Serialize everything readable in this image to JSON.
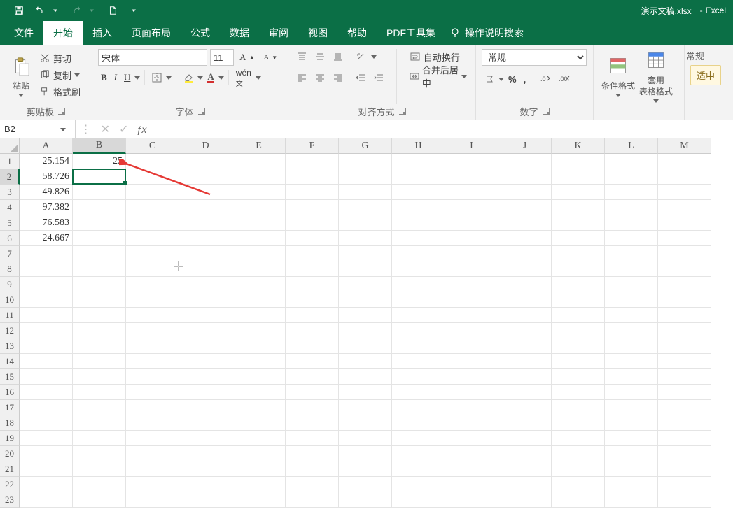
{
  "titlebar": {
    "filename": "演示文稿.xlsx",
    "sep": "-",
    "app": "Excel"
  },
  "tabs": {
    "file": "文件",
    "home": "开始",
    "insert": "插入",
    "layout": "页面布局",
    "formulas": "公式",
    "data": "数据",
    "review": "审阅",
    "view": "视图",
    "help": "帮助",
    "pdf": "PDF工具集",
    "tellme": "操作说明搜索"
  },
  "ribbon": {
    "clipboard": {
      "paste": "粘贴",
      "cut": "剪切",
      "copy": "复制",
      "painter": "格式刷",
      "label": "剪贴板"
    },
    "font": {
      "name": "宋体",
      "size": "11",
      "label": "字体"
    },
    "alignment": {
      "wrap": "自动换行",
      "merge": "合并后居中",
      "label": "对齐方式"
    },
    "number": {
      "format": "常规",
      "label": "数字"
    },
    "styles": {
      "cond": "条件格式",
      "table1": "套用",
      "table2": "表格格式",
      "cell": "适中"
    },
    "styles_group_label": "常规"
  },
  "namebox": {
    "value": "B2"
  },
  "formula": {
    "value": ""
  },
  "grid": {
    "cols": [
      "A",
      "B",
      "C",
      "D",
      "E",
      "F",
      "G",
      "H",
      "I",
      "J",
      "K",
      "L",
      "M"
    ],
    "rows": 23,
    "selected_col": "B",
    "selected_row": 2,
    "data": {
      "A1": "25.154",
      "B1": "25",
      "A2": "58.726",
      "A3": "49.826",
      "A4": "97.382",
      "A5": "76.583",
      "A6": "24.667"
    }
  }
}
